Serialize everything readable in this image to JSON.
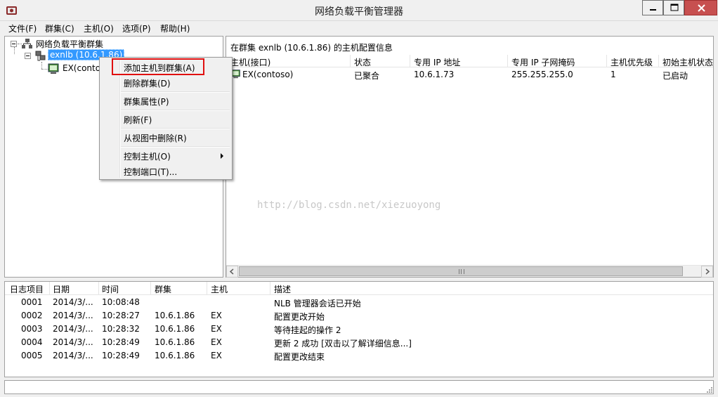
{
  "window": {
    "title": "网络负载平衡管理器"
  },
  "menubar": {
    "items": [
      "文件(F)",
      "群集(C)",
      "主机(O)",
      "选项(P)",
      "帮助(H)"
    ]
  },
  "tree": {
    "root_label": "网络负载平衡群集",
    "cluster_label": "exnlb (10.6.1.86)",
    "host_label": "EX(contoso)"
  },
  "context_menu": {
    "items": [
      "添加主机到群集(A)",
      "删除群集(D)",
      "群集属性(P)",
      "刷新(F)",
      "从视图中删除(R)",
      "控制主机(O)",
      "控制端口(T)..."
    ]
  },
  "right_pane": {
    "header": "在群集 exnlb (10.6.1.86) 的主机配置信息",
    "columns": [
      "主机(接口)",
      "状态",
      "专用 IP 地址",
      "专用 IP 子网掩码",
      "主机优先级",
      "初始主机状态"
    ],
    "rows": [
      [
        "EX(contoso)",
        "已聚合",
        "10.6.1.73",
        "255.255.255.0",
        "1",
        "已启动"
      ]
    ],
    "watermark": "http://blog.csdn.net/xiezuoyong"
  },
  "log": {
    "columns": [
      "日志项目",
      "日期",
      "时间",
      "群集",
      "主机",
      "描述"
    ],
    "rows": [
      [
        "0001",
        "2014/3/...",
        "10:08:48",
        "",
        "",
        "NLB 管理器会话已开始"
      ],
      [
        "0002",
        "2014/3/...",
        "10:28:27",
        "10.6.1.86",
        "EX",
        "配置更改开始"
      ],
      [
        "0003",
        "2014/3/...",
        "10:28:32",
        "10.6.1.86",
        "EX",
        "等待挂起的操作 2"
      ],
      [
        "0004",
        "2014/3/...",
        "10:28:49",
        "10.6.1.86",
        "EX",
        "更新 2 成功 [双击以了解详细信息...]"
      ],
      [
        "0005",
        "2014/3/...",
        "10:28:49",
        "10.6.1.86",
        "EX",
        "配置更改结束"
      ]
    ]
  },
  "colors": {
    "selection": "#3399ff",
    "highlight_box": "#e01010",
    "close_button": "#c75050"
  },
  "icons": [
    "nlb-app-icon",
    "minimize-icon",
    "maximize-icon",
    "close-icon",
    "cluster-tree-icon",
    "cluster-icon",
    "host-icon",
    "submenu-arrow-icon",
    "scroll-left-icon",
    "scroll-right-icon",
    "size-grip-icon"
  ]
}
